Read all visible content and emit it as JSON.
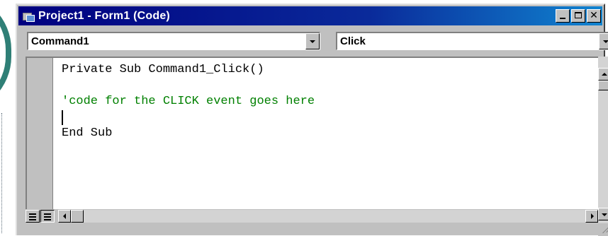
{
  "window": {
    "title": "Project1 - Form1 (Code)",
    "buttons": {
      "minimize": "minimize-icon",
      "maximize": "maximize-icon",
      "close": "✕"
    }
  },
  "object_combo": {
    "selected": "Command1"
  },
  "procedure_combo": {
    "selected": "Click"
  },
  "code": {
    "lines": [
      {
        "text": "Private Sub Command1_Click()",
        "kind": "keyword"
      },
      {
        "text": "'code for the CLICK event goes here",
        "kind": "comment"
      },
      {
        "text": "End Sub",
        "kind": "keyword"
      }
    ]
  },
  "colors": {
    "titlebar": "#000080",
    "comment": "#008000",
    "chrome": "#c0c0c0"
  },
  "icons": {
    "title": "vb-form-icon",
    "procedure_view": "procedure-view-icon",
    "full_module_view": "full-module-view-icon"
  }
}
